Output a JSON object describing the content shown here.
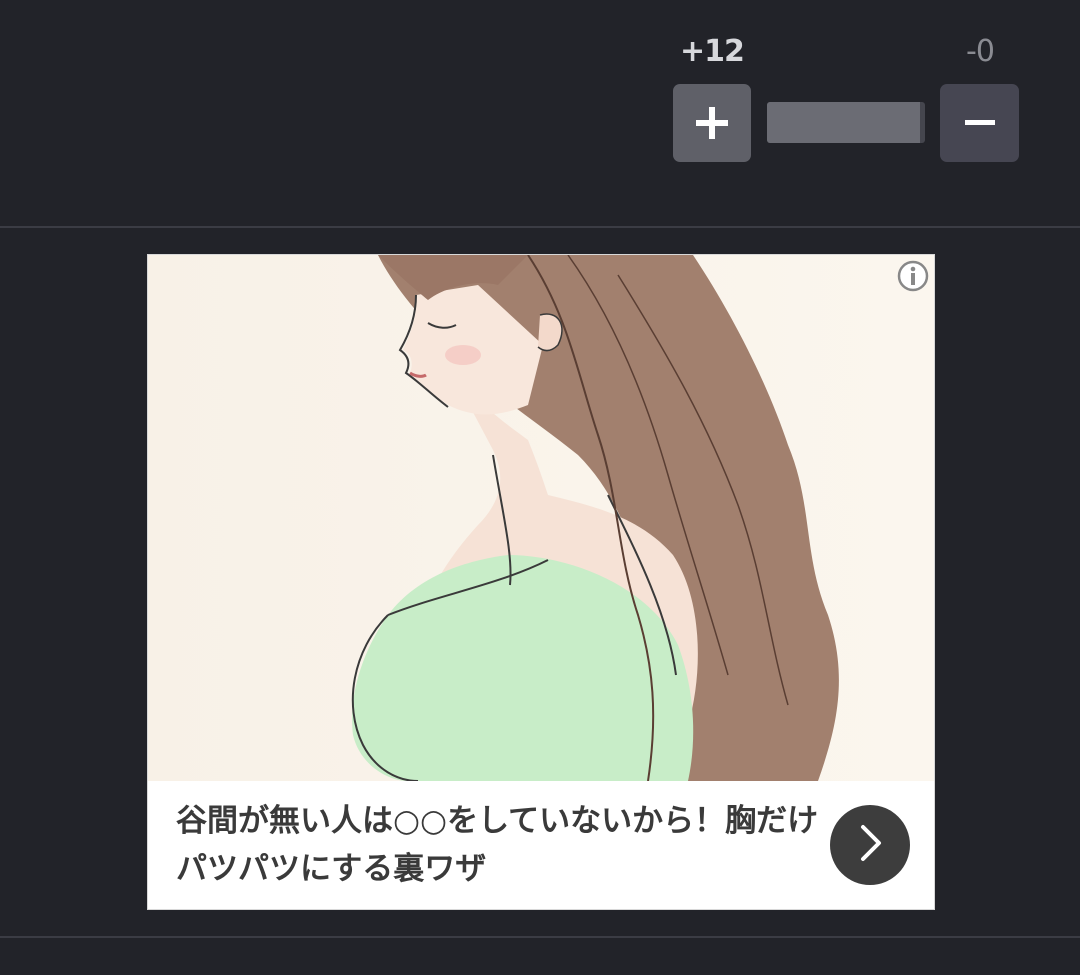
{
  "vote": {
    "plus_count": "+12",
    "minus_count": "-0",
    "plus_icon": "plus-icon",
    "minus_icon": "minus-icon",
    "plus_ratio": 0.97
  },
  "ad": {
    "headline": "谷間が無い人は○○をしていないから！胸だけパツパツにする裏ワザ",
    "info_icon": "info-icon",
    "arrow_icon": "chevron-right-icon"
  },
  "colors": {
    "background": "#222329",
    "plus_button": "#5f6068",
    "minus_button": "#464652",
    "ad_arrow": "#3d3d3d"
  }
}
